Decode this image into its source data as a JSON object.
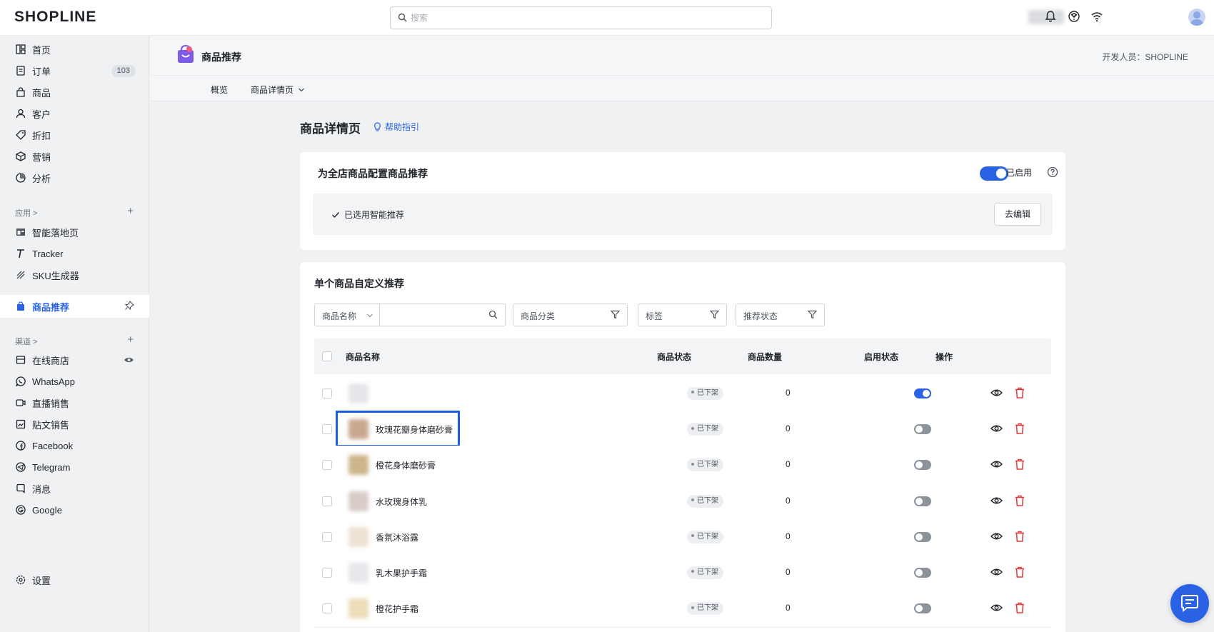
{
  "brand": {
    "logo_text": "SHOPLINE",
    "accent": "#2a62e6",
    "highlight": "#1a5fe0",
    "delete": "#e5383b"
  },
  "topbar": {
    "search_placeholder": "搜索",
    "icons": [
      "bell-icon",
      "help-icon",
      "wifi-icon",
      "user-avatar-icon"
    ]
  },
  "sidebar": {
    "main": [
      {
        "label": "首页",
        "icon": "dashboard-icon"
      },
      {
        "label": "订单",
        "icon": "order-icon",
        "badge": "103"
      },
      {
        "label": "商品",
        "icon": "bag-icon"
      },
      {
        "label": "客户",
        "icon": "user-icon"
      },
      {
        "label": "折扣",
        "icon": "tag-icon"
      },
      {
        "label": "营销",
        "icon": "marketing-icon"
      },
      {
        "label": "分析",
        "icon": "analytics-icon"
      }
    ],
    "apps_label": "应用 >",
    "apps": [
      {
        "label": "智能落地页",
        "icon": "landing-page-icon"
      },
      {
        "label": "Tracker",
        "icon": "tracker-icon"
      },
      {
        "label": "SKU生成器",
        "icon": "sku-icon"
      }
    ],
    "active_app": {
      "label": "商品推荐",
      "icon": "product-recommend-icon"
    },
    "channels_label": "渠道 >",
    "channels": [
      {
        "label": "在线商店",
        "icon": "store-icon"
      },
      {
        "label": "WhatsApp",
        "icon": "whatsapp-icon"
      },
      {
        "label": "直播销售",
        "icon": "live-icon"
      },
      {
        "label": "贴文销售",
        "icon": "post-icon"
      },
      {
        "label": "Facebook",
        "icon": "facebook-icon"
      },
      {
        "label": "Telegram",
        "icon": "telegram-icon"
      },
      {
        "label": "消息",
        "icon": "message-icon"
      },
      {
        "label": "Google",
        "icon": "google-icon"
      }
    ],
    "settings": "设置"
  },
  "app_header": {
    "name": "商品推荐",
    "developer": "开发人员：SHOPLINE"
  },
  "subnav": {
    "tabs": [
      "概览",
      "商品详情页"
    ]
  },
  "page": {
    "title": "商品详情页",
    "help": "帮助指引"
  },
  "global_card": {
    "title": "为全店商品配置商品推荐",
    "enabled": true,
    "enabled_label": "已启用",
    "selected_text": "已选用智能推荐",
    "edit_button": "去编辑"
  },
  "custom_card": {
    "title": "单个商品自定义推荐",
    "filters": {
      "name_select": "商品名称",
      "category": "商品分类",
      "tag": "标签",
      "status": "推荐状态"
    },
    "columns": [
      "商品名称",
      "商品状态",
      "商品数量",
      "启用状态",
      "操作"
    ],
    "rows": [
      {
        "name": "",
        "status": "已下架",
        "qty": "0",
        "enabled": true,
        "thumb": "#e4e6ea"
      },
      {
        "name": "玫瑰花瓣身体磨砂膏",
        "status": "已下架",
        "qty": "0",
        "enabled": false,
        "thumb": "#c9a88e"
      },
      {
        "name": "橙花身体磨砂膏",
        "status": "已下架",
        "qty": "0",
        "enabled": false,
        "thumb": "#cdb58c"
      },
      {
        "name": "水玫瑰身体乳",
        "status": "已下架",
        "qty": "0",
        "enabled": false,
        "thumb": "#d7ccc7"
      },
      {
        "name": "香氛沐浴露",
        "status": "已下架",
        "qty": "0",
        "enabled": false,
        "thumb": "#ede1d4"
      },
      {
        "name": "乳木果护手霜",
        "status": "已下架",
        "qty": "0",
        "enabled": false,
        "thumb": "#e6e8ec"
      },
      {
        "name": "橙花护手霜",
        "status": "已下架",
        "qty": "0",
        "enabled": false,
        "thumb": "#ecdcb8"
      }
    ]
  }
}
